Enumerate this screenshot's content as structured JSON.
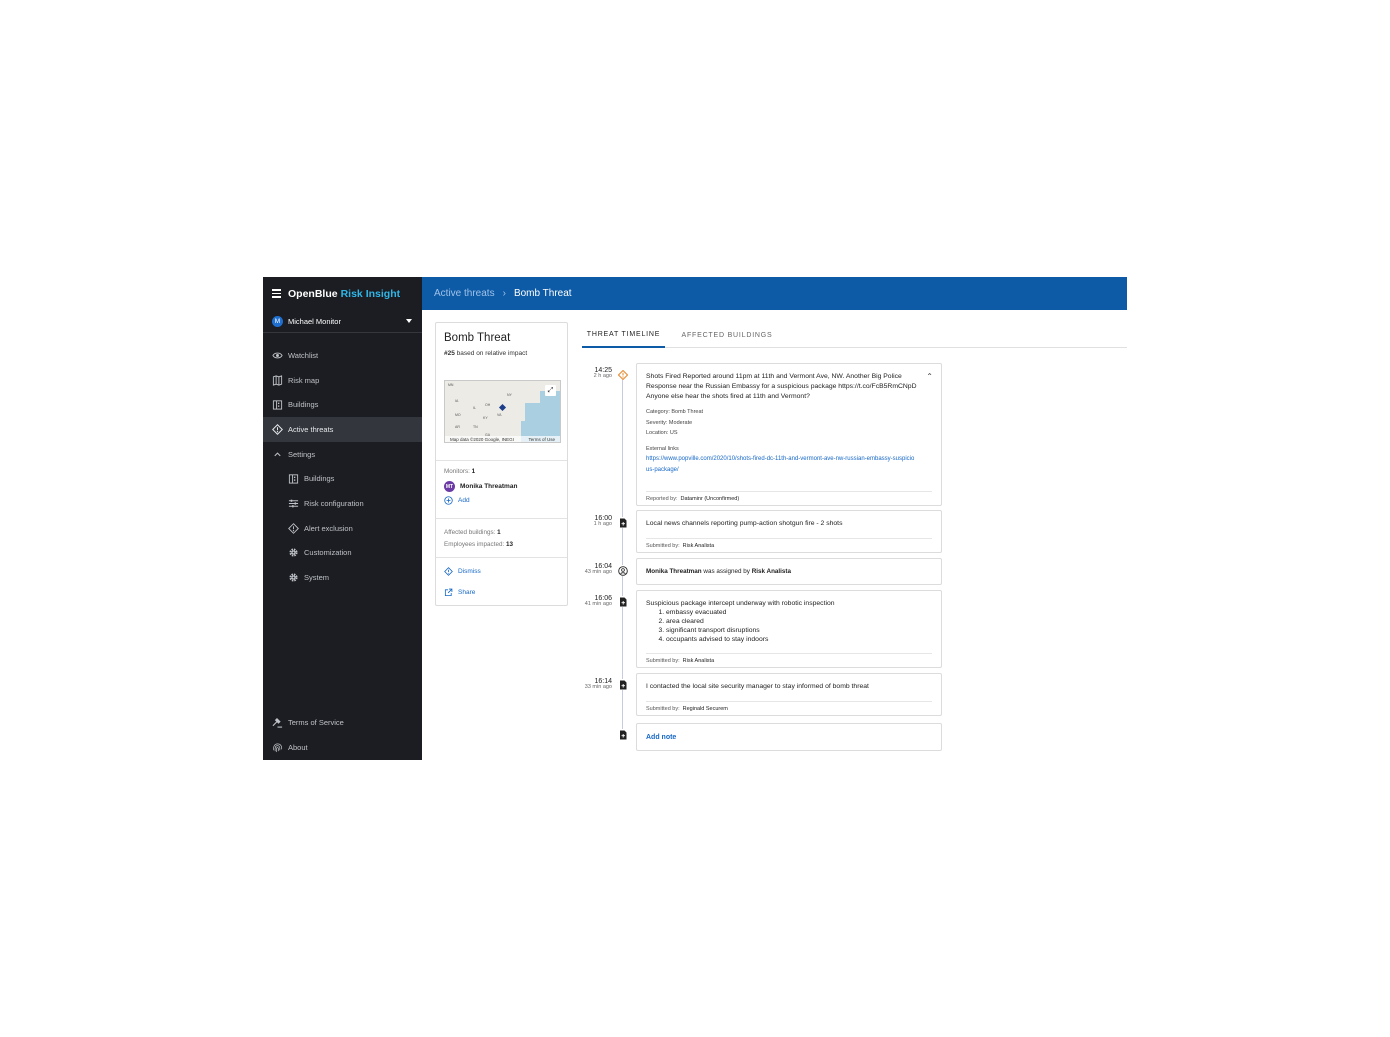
{
  "app": {
    "brand_main": "OpenBlue",
    "brand_accent": "Risk Insight",
    "user_initial": "M",
    "user_name": "Michael Monitor"
  },
  "sidebar": {
    "items": [
      {
        "label": "Watchlist",
        "icon": "eye-icon"
      },
      {
        "label": "Risk map",
        "icon": "map-icon"
      },
      {
        "label": "Buildings",
        "icon": "building-icon"
      },
      {
        "label": "Active threats",
        "icon": "diamond-alert-icon"
      },
      {
        "label": "Settings",
        "icon": "chevron-up-icon"
      }
    ],
    "settings_items": [
      {
        "label": "Buildings",
        "icon": "building-icon"
      },
      {
        "label": "Risk configuration",
        "icon": "sliders-icon"
      },
      {
        "label": "Alert exclusion",
        "icon": "diamond-alert-icon"
      },
      {
        "label": "Customization",
        "icon": "gear-icon"
      },
      {
        "label": "System",
        "icon": "gear-icon"
      }
    ],
    "bottom": [
      {
        "label": "Terms of Service",
        "icon": "gavel-icon"
      },
      {
        "label": "About",
        "icon": "fingerprint-icon"
      }
    ]
  },
  "header": {
    "crumb1": "Active threats",
    "separator": "›",
    "crumb2": "Bomb Threat"
  },
  "summary": {
    "title": "Bomb Threat",
    "rank": "#25",
    "rank_suffix": "based on relative impact",
    "map_attribution": "Map data ©2020 Google, INEGI",
    "map_terms": "Terms of Use",
    "monitors_label": "Monitors:",
    "monitors_count": "1",
    "monitor_initials": "MT",
    "monitor_name": "Monika Threatman",
    "add_label": "Add",
    "affected_buildings_label": "Affected buildings:",
    "affected_buildings_count": "1",
    "employees_label": "Employees impacted:",
    "employees_count": "13",
    "dismiss_label": "Dismiss",
    "share_label": "Share"
  },
  "tabs": {
    "timeline": "THREAT TIMELINE",
    "buildings": "AFFECTED BUILDINGS"
  },
  "timeline": [
    {
      "time": "14:25",
      "ago": "2 h ago",
      "text": "Shots Fired Reported around 11pm at 11th and Vermont Ave, NW. Another Big Police Response near the Russian Embassy for a suspicious package https://t.co/FcB5RmCNpD Anyone else hear the shots fired at 11th and Vermont?",
      "category": "Category: Bomb Threat",
      "severity": "Severity: Moderate",
      "location": "Location: US",
      "links_label": "External links",
      "link": "https://www.popville.com/2020/10/shots-fired-dc-11th-and-vermont-ave-nw-russian-embassy-suspicious-package/",
      "reported_label": "Reported by:",
      "reported_by": "Dataminr (Unconfirmed)"
    },
    {
      "time": "16:00",
      "ago": "1 h ago",
      "text": "Local news channels reporting pump-action shotgun fire - 2 shots",
      "submitted_label": "Submitted by:",
      "submitted_by": "Risk Analista"
    },
    {
      "time": "16:04",
      "ago": "43 min ago",
      "assignee": "Monika Threatman",
      "assigned_text": "was assigned by",
      "assigner": "Risk Analista"
    },
    {
      "time": "16:06",
      "ago": "41 min ago",
      "text": "Suspicious package intercept underway with robotic inspection",
      "list": [
        "embassy evacuated",
        "area cleared",
        "significant transport disruptions",
        "occupants advised to stay indoors"
      ],
      "submitted_label": "Submitted by:",
      "submitted_by": "Risk Analista"
    },
    {
      "time": "16:14",
      "ago": "33 min ago",
      "text": "I contacted the local site security manager to stay informed of bomb threat",
      "submitted_label": "Submitted by:",
      "submitted_by": "Reginald Securem"
    }
  ],
  "add_note": "Add note",
  "colors": {
    "header_blue": "#0d5aa6",
    "sidebar_bg": "#1b1d22",
    "accent_cyan": "#2fb6e8",
    "link_blue": "#1668c7",
    "alert_orange": "#e8872a"
  }
}
